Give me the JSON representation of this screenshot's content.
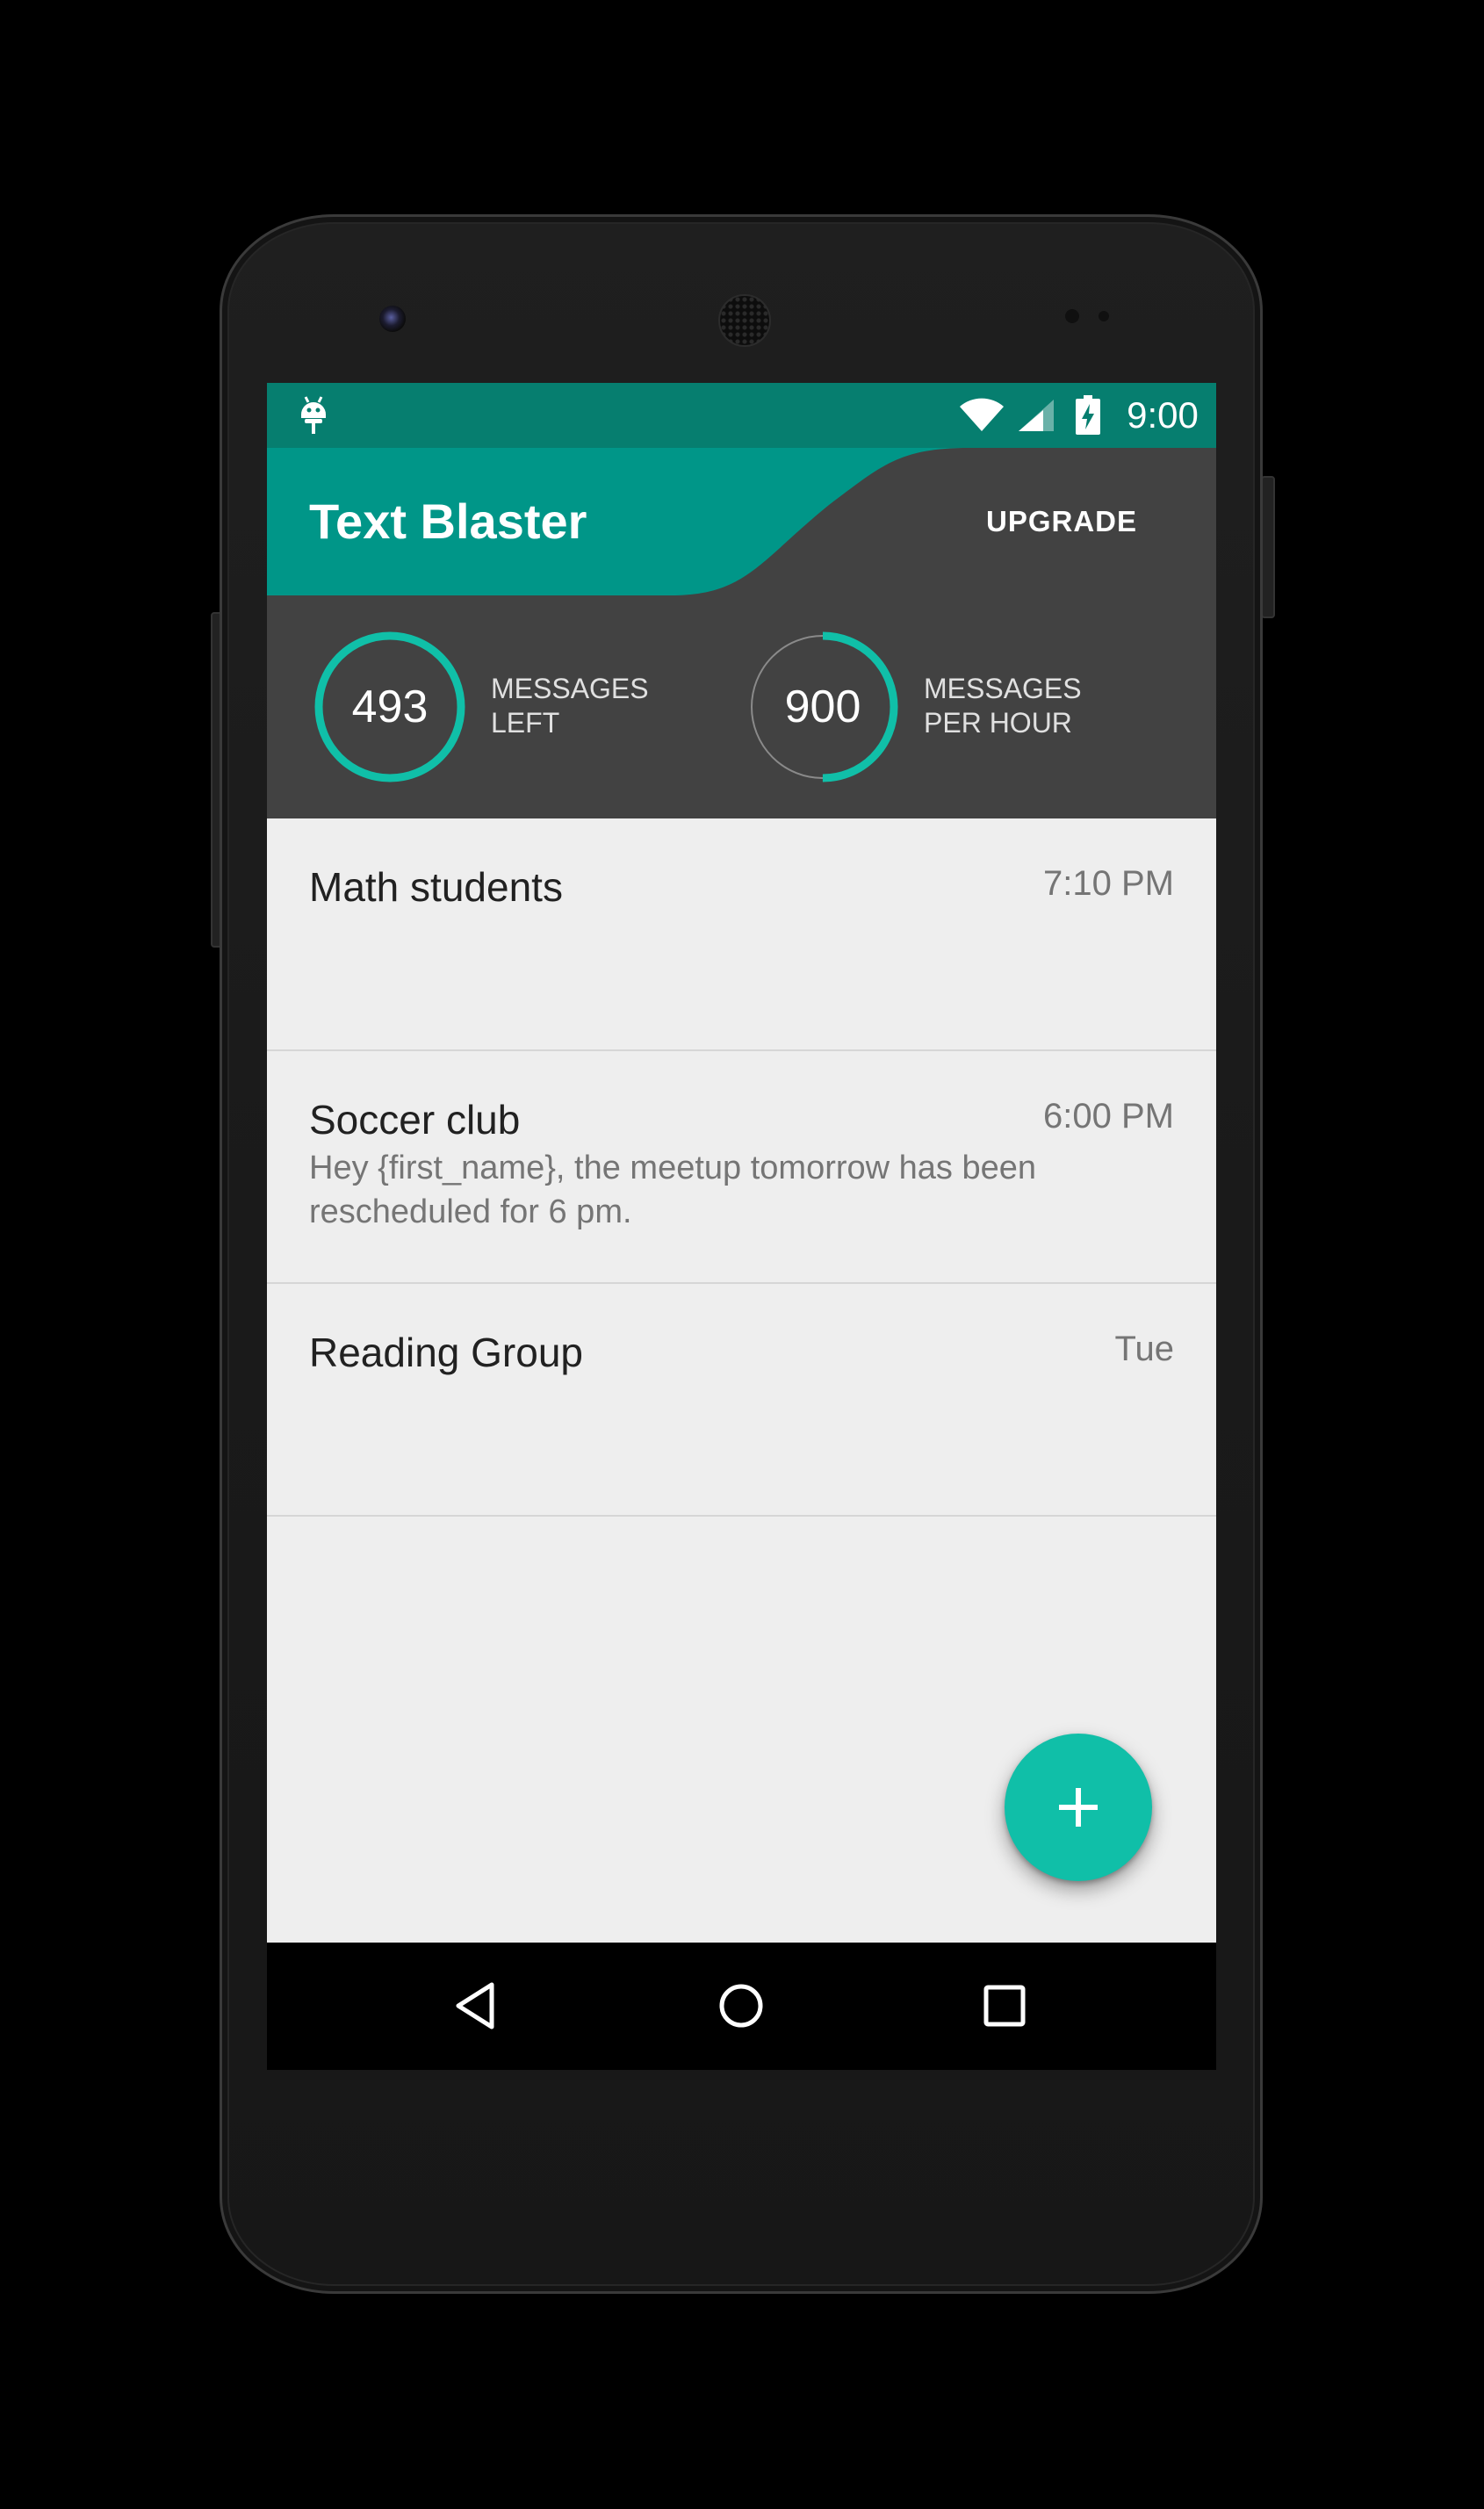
{
  "status_bar": {
    "time": "9:00",
    "icons": [
      "android-icon",
      "wifi-icon",
      "signal-icon",
      "battery-charging-icon"
    ]
  },
  "app_bar": {
    "title": "Text Blaster",
    "action_label": "UPGRADE"
  },
  "stats": {
    "messages_left": {
      "value": "493",
      "label_line1": "MESSAGES",
      "label_line2": "LEFT",
      "progress": 1.0
    },
    "messages_per_hour": {
      "value": "900",
      "label_line1": "MESSAGES",
      "label_line2": "PER HOUR",
      "progress": 0.5
    }
  },
  "groups": [
    {
      "name": "Math students",
      "time": "7:10 PM",
      "preview": ""
    },
    {
      "name": "Soccer club",
      "time": "6:00 PM",
      "preview": "Hey {first_name}, the meetup tomorrow has been rescheduled for 6 pm."
    },
    {
      "name": "Reading Group",
      "time": "Tue",
      "preview": ""
    }
  ],
  "fab": {
    "icon": "plus-icon"
  },
  "nav_bar": {
    "icons": [
      "back-icon",
      "home-icon",
      "recents-icon"
    ]
  },
  "colors": {
    "status_bar": "#067e6f",
    "primary": "#009688",
    "accent": "#10bfa8",
    "header_dark": "#424242",
    "background": "#eeeeee"
  }
}
